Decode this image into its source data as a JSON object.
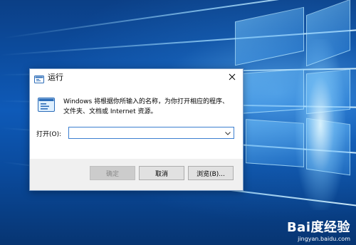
{
  "dialog": {
    "title": "运行",
    "description": "Windows 将根据你所输入的名称，为你打开相应的程序、文件夹、文档或 Internet 资源。",
    "open_label": "打开(O):",
    "input_value": "",
    "buttons": {
      "ok": "确定",
      "cancel": "取消",
      "browse": "浏览(B)..."
    }
  },
  "watermark": {
    "brand": "Bai度经验",
    "url": "jingyan.baidu.com"
  },
  "colors": {
    "desktop": "#0e5ab8",
    "dialog_border": "#7a9cc6",
    "input_focus": "#3c7fd0",
    "footer": "#f0f0f0"
  },
  "icons": {
    "title": "run-icon",
    "body": "run-icon",
    "close": "close-icon",
    "dropdown": "chevron-down-icon",
    "watermark": "baidu-paw-icon"
  }
}
